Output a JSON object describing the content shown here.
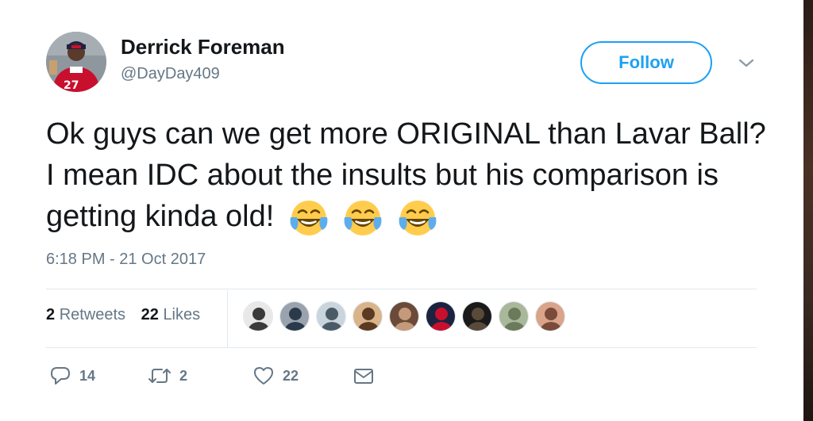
{
  "user": {
    "name": "Derrick Foreman",
    "handle": "@DayDay409"
  },
  "follow_label": "Follow",
  "tweet": {
    "text": "Ok guys can we get more ORIGINAL than Lavar Ball? I mean IDC about the insults but his comparison is getting kinda old!",
    "emojis": [
      "face-with-tears-of-joy",
      "face-with-tears-of-joy",
      "face-with-tears-of-joy"
    ],
    "timestamp": "6:18 PM - 21 Oct 2017"
  },
  "stats": {
    "retweets_count": "2",
    "retweets_label": "Retweets",
    "likes_count": "22",
    "likes_label": "Likes"
  },
  "likers": [
    {
      "colors": [
        "#e8e8e8",
        "#3a3a3a"
      ]
    },
    {
      "colors": [
        "#9aa3ad",
        "#2b3a4a"
      ]
    },
    {
      "colors": [
        "#c9d4dc",
        "#4a5a66"
      ]
    },
    {
      "colors": [
        "#d9b48a",
        "#5a3a22"
      ]
    },
    {
      "colors": [
        "#6b4a3a",
        "#c49a7a"
      ]
    },
    {
      "colors": [
        "#1c2340",
        "#c8102e"
      ]
    },
    {
      "colors": [
        "#1a1a1a",
        "#5a4a3a"
      ]
    },
    {
      "colors": [
        "#a9b89a",
        "#6a7a5a"
      ]
    },
    {
      "colors": [
        "#d9a48a",
        "#7a4a3a"
      ]
    }
  ],
  "actions": {
    "reply_count": "14",
    "retweet_count": "2",
    "like_count": "22"
  },
  "colors": {
    "accent": "#1da1f2",
    "text_primary": "#14171a",
    "text_secondary": "#657786",
    "divider": "#e1e8ed"
  },
  "icons": {
    "reply": "reply-icon",
    "retweet": "retweet-icon",
    "like": "heart-icon",
    "dm": "envelope-icon",
    "more": "chevron-down-icon"
  }
}
